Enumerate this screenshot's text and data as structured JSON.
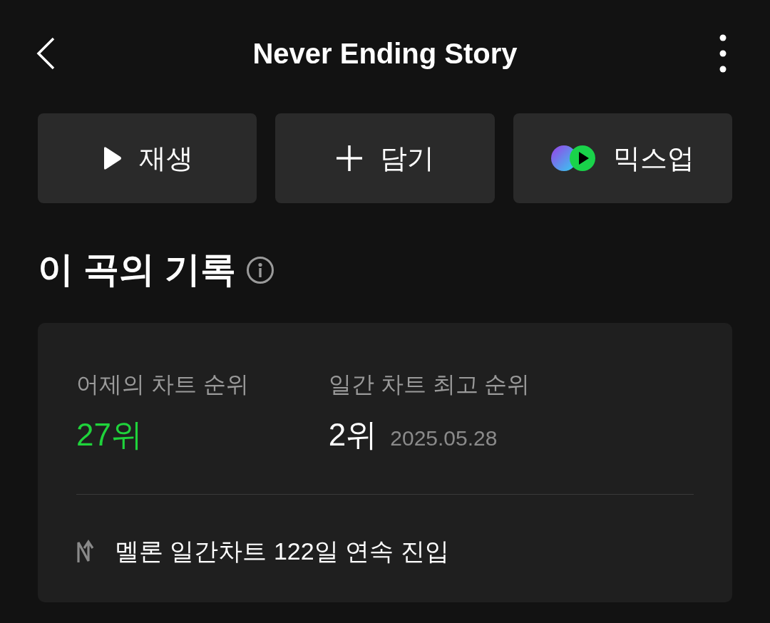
{
  "header": {
    "title": "Never Ending Story"
  },
  "actions": [
    {
      "kind": "play",
      "label": "재생"
    },
    {
      "kind": "add",
      "label": "담기"
    },
    {
      "kind": "mixup",
      "label": "믹스업"
    }
  ],
  "section": {
    "title": "이 곡의 기록"
  },
  "stats": [
    {
      "label": "어제의 차트 순위",
      "value": "27위",
      "highlight": true
    },
    {
      "label": "일간 차트 최고 순위",
      "value": "2위",
      "date": "2025.05.28",
      "highlight": false
    }
  ],
  "streak": {
    "text": "멜론 일간차트 122일 연속 진입"
  }
}
